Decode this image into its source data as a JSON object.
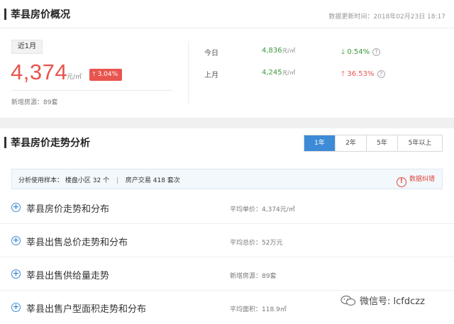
{
  "overview": {
    "title": "莘县房价概况",
    "update_time": "数据更新时间：2018年02月23日 18:17",
    "period_label": "近1月",
    "price": "4,374",
    "price_unit": "元/㎡",
    "change": "3.04%",
    "new_listings": "新增房源：89套",
    "today": {
      "label": "今日",
      "price": "4,836",
      "unit": "元/㎡",
      "change": "0.54%"
    },
    "last_month": {
      "label": "上月",
      "price": "4,245",
      "unit": "元/㎡",
      "change": "36.53%"
    }
  },
  "trend": {
    "title": "莘县房价走势分析",
    "range_tabs": [
      "1年",
      "2年",
      "5年",
      "5年以上"
    ],
    "active_tab": "1年",
    "sample": {
      "label": "分析使用样本：",
      "communities": "楼盘小区 32 个",
      "separator": "|",
      "transactions": "房产交易 418 套次"
    },
    "report_label": "数据纠错",
    "rows": [
      {
        "title": "莘县房价走势和分布",
        "summary": "平均单价：4,374元/㎡"
      },
      {
        "title": "莘县出售总价走势和分布",
        "summary": "平均总价：52万元"
      },
      {
        "title": "莘县出售供给量走势",
        "summary": "新增房源：89套"
      },
      {
        "title": "莘县出售户型面积走势和分布",
        "summary": "平均面积：118.9㎡"
      }
    ]
  },
  "watermark": "微信号: lcfdczz",
  "colors": {
    "accent": "#3d8ad6",
    "up": "#e8554e",
    "down": "#3a9a3a"
  }
}
